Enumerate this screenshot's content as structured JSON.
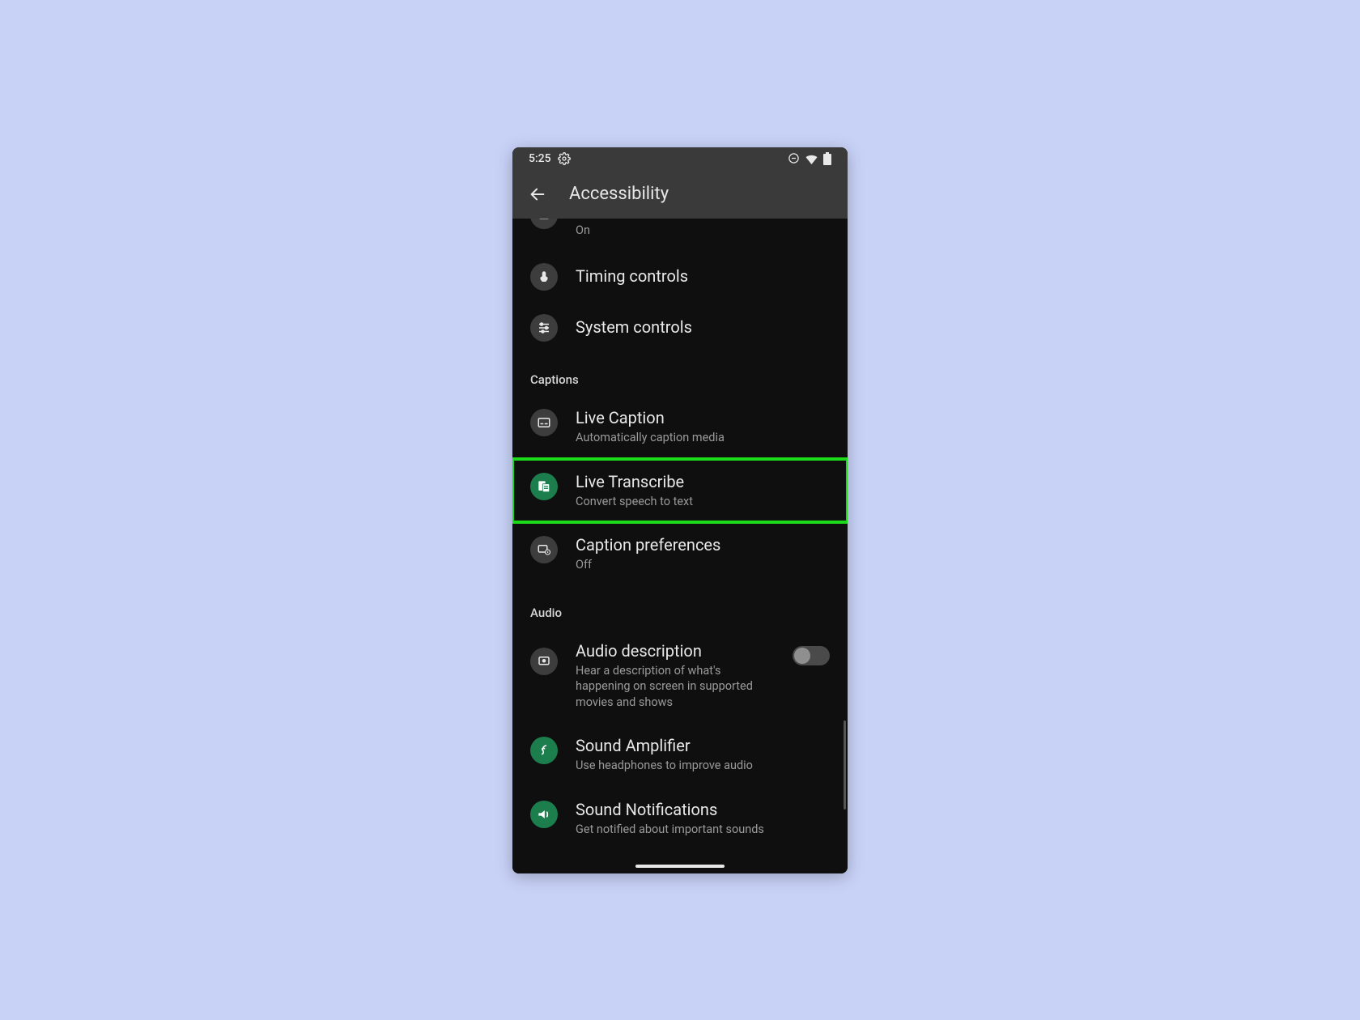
{
  "statusbar": {
    "time": "5:25"
  },
  "appbar": {
    "title": "Accessibility"
  },
  "rows": {
    "partial": {
      "sub": "On"
    },
    "timing": {
      "title": "Timing controls"
    },
    "system": {
      "title": "System controls"
    },
    "live_caption": {
      "title": "Live Caption",
      "sub": "Automatically caption media"
    },
    "live_transcribe": {
      "title": "Live Transcribe",
      "sub": "Convert speech to text"
    },
    "caption_prefs": {
      "title": "Caption preferences",
      "sub": "Off"
    },
    "audio_desc": {
      "title": "Audio description",
      "sub": "Hear a description of what's happening on screen in supported movies and shows"
    },
    "sound_amp": {
      "title": "Sound Amplifier",
      "sub": "Use headphones to improve audio"
    },
    "sound_notif": {
      "title": "Sound Notifications",
      "sub": "Get notified about important sounds"
    }
  },
  "sections": {
    "captions": "Captions",
    "audio": "Audio"
  },
  "colors": {
    "highlight": "#1bdb1b",
    "green_icon": "#1c7d4d",
    "page_bg": "#c8d2f7"
  }
}
